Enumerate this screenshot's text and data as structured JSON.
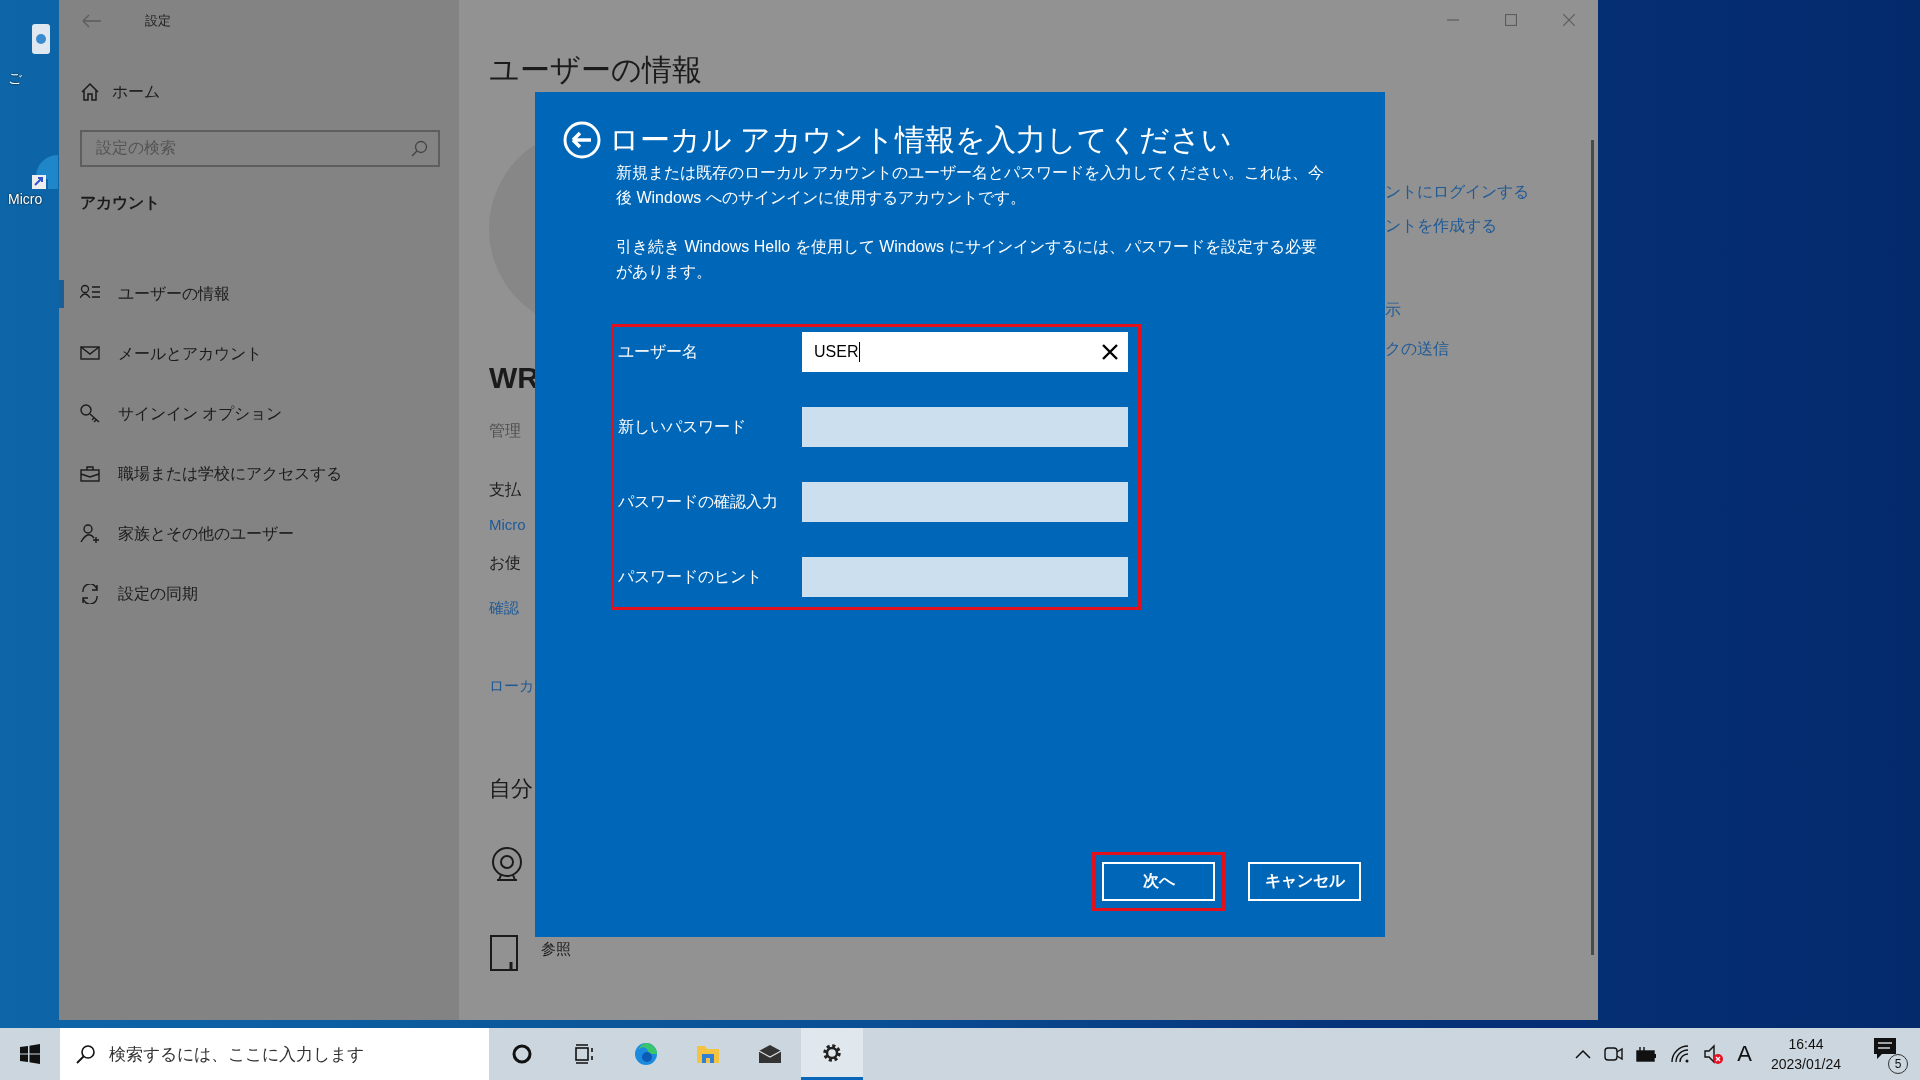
{
  "desktop": {
    "icons": [
      {
        "label": "ご"
      },
      {
        "label": "Micro"
      }
    ]
  },
  "settings_window": {
    "title": "設定",
    "home": "ホーム",
    "search": {
      "placeholder": "設定の検索"
    },
    "section": "アカウント",
    "nav": [
      {
        "label": "ユーザーの情報",
        "selected": true
      },
      {
        "label": "メールとアカウント",
        "selected": false
      },
      {
        "label": "サインイン オプション",
        "selected": false
      },
      {
        "label": "職場または学校にアクセスする",
        "selected": false
      },
      {
        "label": "家族とその他のユーザー",
        "selected": false
      },
      {
        "label": "設定の同期",
        "selected": false
      }
    ],
    "content": {
      "title": "ユーザーの情報",
      "left_texts": [
        {
          "kind": "heading",
          "text": "WR"
        },
        {
          "kind": "note",
          "text": "管理"
        },
        {
          "kind": "text",
          "text": "支払"
        },
        {
          "kind": "link",
          "text": "Micro"
        },
        {
          "kind": "text",
          "text": "お使"
        },
        {
          "kind": "link",
          "text": "確認"
        },
        {
          "kind": "link",
          "text": "ローカ"
        },
        {
          "kind": "subheading",
          "text": "自分"
        }
      ],
      "right_links": [
        {
          "text": "ントにログインする"
        },
        {
          "text": "ントを作成する"
        },
        {
          "text": "示"
        },
        {
          "text": "クの送信"
        }
      ],
      "browse_label": "参照"
    }
  },
  "dialog": {
    "title": "ローカル アカウント情報を入力してください",
    "paragraphs": [
      "新規または既存のローカル アカウントのユーザー名とパスワードを入力してください。これは、今後 Windows へのサインインに使用するアカウントです。",
      "引き続き Windows Hello を使用して Windows にサインインするには、パスワードを設定する必要があります。"
    ],
    "fields_highlighted": true,
    "fields": [
      {
        "label": "ユーザー名",
        "value": "USER",
        "focused": true
      },
      {
        "label": "新しいパスワード",
        "focused": false
      },
      {
        "label": "パスワードの確認入力",
        "focused": false
      },
      {
        "label": "パスワードのヒント",
        "focused": false
      }
    ],
    "buttons": [
      {
        "label": "次へ",
        "highlighted": true
      },
      {
        "label": "キャンセル",
        "highlighted": false
      }
    ]
  },
  "taskbar": {
    "search": {
      "placeholder": "検索するには、ここに入力します"
    },
    "apps": [
      {
        "kind": "cortana",
        "selected": false
      },
      {
        "kind": "taskview",
        "selected": false
      },
      {
        "kind": "edge",
        "selected": false
      },
      {
        "kind": "explorer",
        "selected": false
      },
      {
        "kind": "mail",
        "selected": false
      },
      {
        "kind": "settings",
        "selected": true
      }
    ],
    "volume_muted": true,
    "ime": "A",
    "clock": {
      "time": "16:44",
      "date": "2023/01/24"
    },
    "notifications": "5"
  }
}
